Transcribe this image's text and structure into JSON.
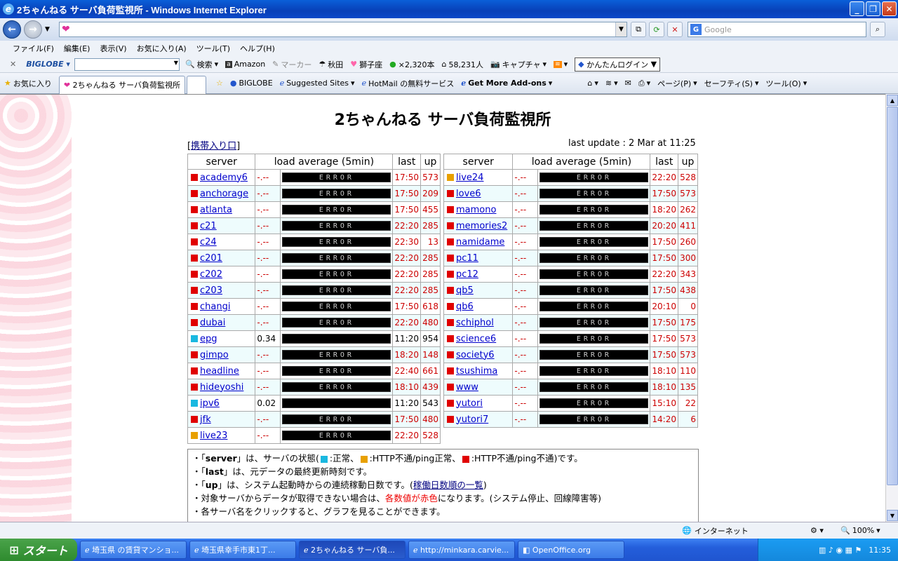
{
  "window": {
    "title": "2ちゃんねる サーバ負荷監視所 - Windows Internet Explorer"
  },
  "search": {
    "placeholder": "Google"
  },
  "menu": [
    "ファイル(F)",
    "編集(E)",
    "表示(V)",
    "お気に入り(A)",
    "ツール(T)",
    "ヘルプ(H)"
  ],
  "toolbar": {
    "search": "検索",
    "amazon": "Amazon",
    "marker": "マーカー",
    "akita": "秋田",
    "shishiza": "獅子座",
    "books": "×2,320本",
    "people": "58,231人",
    "capture": "キャプチャ",
    "login": "かんたんログイン"
  },
  "favbar": {
    "favorites": "お気に入り",
    "tab": "2ちゃんねる サーバ負荷監視所",
    "biglobe": "BIGLOBE",
    "suggested": "Suggested Sites",
    "hotmail": "HotMail の無料サービス",
    "addons": "Get More Add-ons",
    "page": "ページ(P)",
    "safety": "セーフティ(S)",
    "tools": "ツール(O)"
  },
  "page": {
    "title": "2ちゃんねる サーバ負荷監視所",
    "keitai": "携帯入り口",
    "last_update": "last update : 2 Mar at 11:25"
  },
  "headers": {
    "server": "server",
    "load": "load average (5min)",
    "last": "last",
    "up": "up"
  },
  "colors": {
    "normal": "#1ab8e0",
    "warn": "#e8a000",
    "error": "#e00000"
  },
  "table_left": [
    {
      "server": "academy6",
      "status": "error",
      "load": "-.--",
      "bar": "ERROR",
      "last": "17:50",
      "up": "573"
    },
    {
      "server": "anchorage",
      "status": "error",
      "load": "-.--",
      "bar": "ERROR",
      "last": "17:50",
      "up": "209"
    },
    {
      "server": "atlanta",
      "status": "error",
      "load": "-.--",
      "bar": "ERROR",
      "last": "17:50",
      "up": "455"
    },
    {
      "server": "c21",
      "status": "error",
      "load": "-.--",
      "bar": "ERROR",
      "last": "22:20",
      "up": "285"
    },
    {
      "server": "c24",
      "status": "error",
      "load": "-.--",
      "bar": "ERROR",
      "last": "22:30",
      "up": "13"
    },
    {
      "server": "c201",
      "status": "error",
      "load": "-.--",
      "bar": "ERROR",
      "last": "22:20",
      "up": "285"
    },
    {
      "server": "c202",
      "status": "error",
      "load": "-.--",
      "bar": "ERROR",
      "last": "22:20",
      "up": "285"
    },
    {
      "server": "c203",
      "status": "error",
      "load": "-.--",
      "bar": "ERROR",
      "last": "22:20",
      "up": "285"
    },
    {
      "server": "changi",
      "status": "error",
      "load": "-.--",
      "bar": "ERROR",
      "last": "17:50",
      "up": "618"
    },
    {
      "server": "dubai",
      "status": "error",
      "load": "-.--",
      "bar": "ERROR",
      "last": "22:20",
      "up": "480"
    },
    {
      "server": "epg",
      "status": "normal",
      "load": "0.34",
      "bar": "",
      "last": "11:20",
      "up": "954"
    },
    {
      "server": "gimpo",
      "status": "error",
      "load": "-.--",
      "bar": "ERROR",
      "last": "18:20",
      "up": "148"
    },
    {
      "server": "headline",
      "status": "error",
      "load": "-.--",
      "bar": "ERROR",
      "last": "22:40",
      "up": "661"
    },
    {
      "server": "hideyoshi",
      "status": "error",
      "load": "-.--",
      "bar": "ERROR",
      "last": "18:10",
      "up": "439"
    },
    {
      "server": "ipv6",
      "status": "normal",
      "load": "0.02",
      "bar": "",
      "last": "11:20",
      "up": "543"
    },
    {
      "server": "jfk",
      "status": "error",
      "load": "-.--",
      "bar": "ERROR",
      "last": "17:50",
      "up": "480"
    },
    {
      "server": "live23",
      "status": "warn",
      "load": "-.--",
      "bar": "ERROR",
      "last": "22:20",
      "up": "528"
    }
  ],
  "table_right": [
    {
      "server": "live24",
      "status": "warn",
      "load": "-.--",
      "bar": "ERROR",
      "last": "22:20",
      "up": "528"
    },
    {
      "server": "love6",
      "status": "error",
      "load": "-.--",
      "bar": "ERROR",
      "last": "17:50",
      "up": "573"
    },
    {
      "server": "mamono",
      "status": "error",
      "load": "-.--",
      "bar": "ERROR",
      "last": "18:20",
      "up": "262"
    },
    {
      "server": "memories2",
      "status": "error",
      "load": "-.--",
      "bar": "ERROR",
      "last": "20:20",
      "up": "411"
    },
    {
      "server": "namidame",
      "status": "error",
      "load": "-.--",
      "bar": "ERROR",
      "last": "17:50",
      "up": "260"
    },
    {
      "server": "pc11",
      "status": "error",
      "load": "-.--",
      "bar": "ERROR",
      "last": "17:50",
      "up": "300"
    },
    {
      "server": "pc12",
      "status": "error",
      "load": "-.--",
      "bar": "ERROR",
      "last": "22:20",
      "up": "343"
    },
    {
      "server": "qb5",
      "status": "error",
      "load": "-.--",
      "bar": "ERROR",
      "last": "17:50",
      "up": "438"
    },
    {
      "server": "qb6",
      "status": "error",
      "load": "-.--",
      "bar": "ERROR",
      "last": "20:10",
      "up": "0"
    },
    {
      "server": "schiphol",
      "status": "error",
      "load": "-.--",
      "bar": "ERROR",
      "last": "17:50",
      "up": "175"
    },
    {
      "server": "science6",
      "status": "error",
      "load": "-.--",
      "bar": "ERROR",
      "last": "17:50",
      "up": "573"
    },
    {
      "server": "society6",
      "status": "error",
      "load": "-.--",
      "bar": "ERROR",
      "last": "17:50",
      "up": "573"
    },
    {
      "server": "tsushima",
      "status": "error",
      "load": "-.--",
      "bar": "ERROR",
      "last": "18:10",
      "up": "110"
    },
    {
      "server": "www",
      "status": "error",
      "load": "-.--",
      "bar": "ERROR",
      "last": "18:10",
      "up": "135"
    },
    {
      "server": "yutori",
      "status": "error",
      "load": "-.--",
      "bar": "ERROR",
      "last": "15:10",
      "up": "22"
    },
    {
      "server": "yutori7",
      "status": "error",
      "load": "-.--",
      "bar": "ERROR",
      "last": "14:20",
      "up": "6"
    }
  ],
  "notes": {
    "n1a": "・「",
    "n1b": "server",
    "n1c": "」は、サーバの状態(",
    "n1d": ":正常、",
    "n1e": ":HTTP不通/ping正常、",
    "n1f": ":HTTP不通/ping不通)です。",
    "n2a": "・「",
    "n2b": "last",
    "n2c": "」は、元データの最終更新時刻です。",
    "n3a": "・「",
    "n3b": "up",
    "n3c": "」は、システム起動時からの連続稼動日数です。(",
    "n3d": "稼働日数順の一覧",
    "n3e": ")",
    "n4a": "・対象サーバからデータが取得できない場合は、",
    "n4b": "各数値が赤色",
    "n4c": "になります。(システム停止、回線障害等)",
    "n5": "・各サーバ名をクリックすると、グラフを見ることができます。"
  },
  "status": {
    "zone": "インターネット",
    "zoom": "100%"
  },
  "taskbar": {
    "start": "スタート",
    "tasks": [
      "埼玉県 の賃貸マンショ...",
      "埼玉県幸手市東1丁...",
      "2ちゃんねる サーバ負...",
      "http://minkara.carvie...",
      "OpenOffice.org"
    ],
    "clock": "11:35"
  }
}
